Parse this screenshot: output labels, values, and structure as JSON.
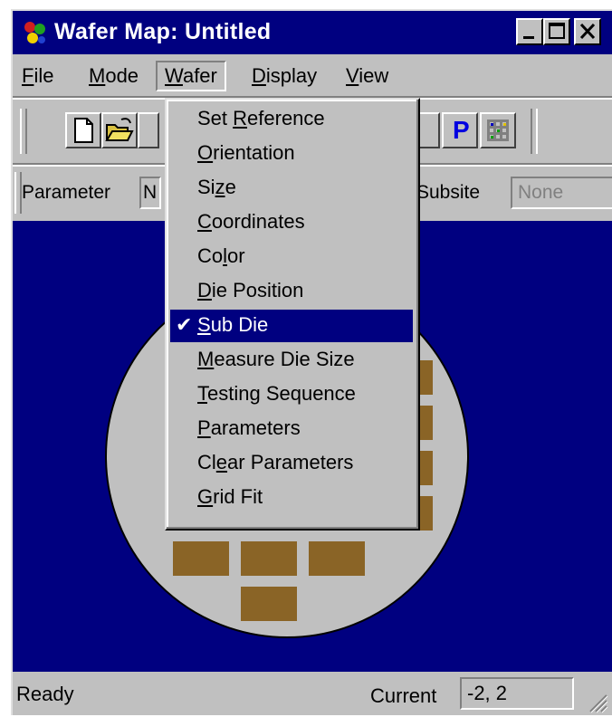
{
  "window": {
    "title": "Wafer Map: Untitled",
    "app_icon": "wafer-map-icon",
    "controls": [
      "minimize-icon",
      "maximize-icon",
      "close-icon"
    ]
  },
  "menubar": {
    "file": {
      "ul": "F",
      "rest": "ile"
    },
    "mode": {
      "ul": "M",
      "rest": "ode"
    },
    "wafer": {
      "ul": "W",
      "rest": "afer"
    },
    "display": {
      "ul": "D",
      "rest": "isplay"
    },
    "view": {
      "ul": "V",
      "rest": "iew"
    }
  },
  "toolbar": {
    "icons": [
      "new-document-icon",
      "open-folder-icon",
      "p-icon",
      "grid-icon"
    ],
    "p_label": "P"
  },
  "params": {
    "parameter_label": "Parameter",
    "parameter_value": "N",
    "subsite_label": "Subsite",
    "subsite_value": "None"
  },
  "wafer_menu": {
    "items": [
      {
        "pre": "Set ",
        "ul": "R",
        "post": "eference",
        "checked": false
      },
      {
        "pre": "",
        "ul": "O",
        "post": "rientation",
        "checked": false
      },
      {
        "pre": "Si",
        "ul": "z",
        "post": "e",
        "checked": false
      },
      {
        "pre": "",
        "ul": "C",
        "post": "oordinates",
        "checked": false
      },
      {
        "pre": "Co",
        "ul": "l",
        "post": "or",
        "checked": false
      },
      {
        "pre": "",
        "ul": "D",
        "post": "ie Position",
        "checked": false
      },
      {
        "pre": "",
        "ul": "S",
        "post": "ub Die",
        "checked": true
      },
      {
        "pre": "",
        "ul": "M",
        "post": "easure Die Size",
        "checked": false
      },
      {
        "pre": "",
        "ul": "T",
        "post": "esting Sequence",
        "checked": false
      },
      {
        "pre": "",
        "ul": "P",
        "post": "arameters",
        "checked": false
      },
      {
        "pre": "Cl",
        "ul": "e",
        "post": "ar Parameters",
        "checked": false
      },
      {
        "pre": "",
        "ul": "G",
        "post": "rid Fit",
        "checked": false
      }
    ],
    "checkmark": "✔"
  },
  "colors": {
    "titlebar": "#000080",
    "canvas_bg": "#000080",
    "wafer": "#c0c0c0",
    "die": "#8a6426",
    "highlight": "#000080"
  },
  "status": {
    "ready": "Ready",
    "current_label": "Current",
    "current_value": "-2, 2"
  }
}
